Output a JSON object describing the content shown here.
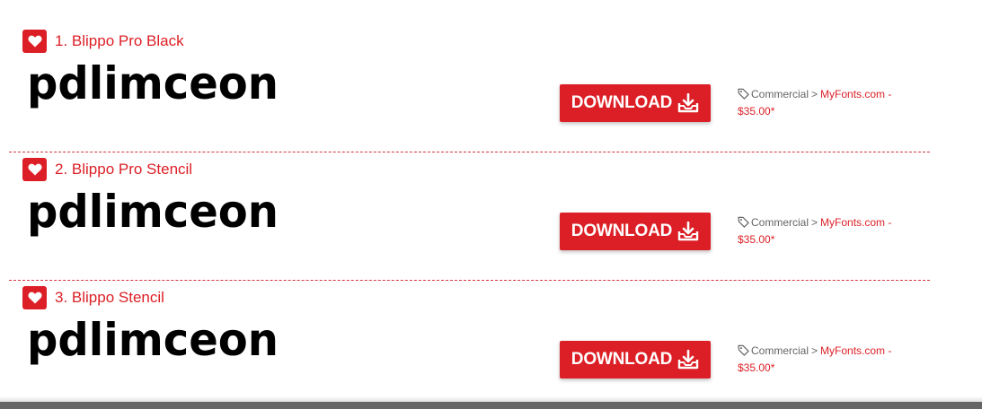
{
  "fonts": [
    {
      "title": "1. Blippo Pro Black",
      "preview_text": "pdlimceon",
      "download_label": "DOWNLOAD",
      "license": "Commercial",
      "separator": ">",
      "vendor": "MyFonts.com -",
      "price": "$35.00*"
    },
    {
      "title": "2. Blippo Pro Stencil",
      "preview_text": "pdlimceon",
      "download_label": "DOWNLOAD",
      "license": "Commercial",
      "separator": ">",
      "vendor": "MyFonts.com -",
      "price": "$35.00*"
    },
    {
      "title": "3. Blippo Stencil",
      "preview_text": "pdlimceon",
      "download_label": "DOWNLOAD",
      "license": "Commercial",
      "separator": ">",
      "vendor": "MyFonts.com -",
      "price": "$35.00*"
    }
  ],
  "icons": {
    "favorite": "heart-icon",
    "download": "download-tray-icon",
    "license": "tag-icon"
  },
  "colors": {
    "accent": "#dc1f26",
    "divider": "#d4373f",
    "meta_text": "#666666",
    "preview_text": "#000000"
  }
}
